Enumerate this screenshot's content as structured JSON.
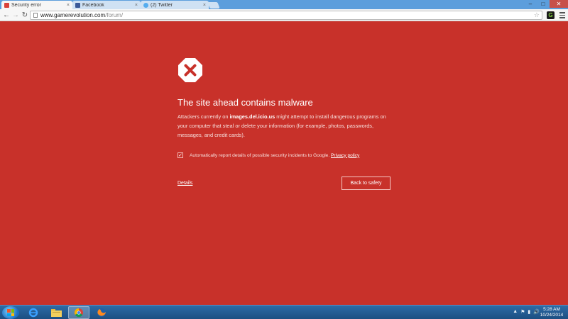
{
  "browser": {
    "tabs": [
      {
        "label": "Security error",
        "active": true,
        "icon": "error-tab-icon"
      },
      {
        "label": "Facebook",
        "active": false,
        "icon": "facebook-icon"
      },
      {
        "label": "(2) Twitter",
        "active": false,
        "icon": "twitter-icon"
      }
    ],
    "close_glyph": "×",
    "window_controls": {
      "minimize": "–",
      "maximize": "□",
      "close": "✕"
    },
    "nav": {
      "back": "←",
      "forward": "→",
      "reload": "↻"
    },
    "address": {
      "host": "www.gamerevolution.com",
      "path": "/forum/"
    },
    "star": "☆",
    "extension_label": "G",
    "colors": {
      "tabstrip": "#5c9edc",
      "page_bg": "#c8312a"
    }
  },
  "warning": {
    "title": "The site ahead contains malware",
    "body_prefix": "Attackers currently on ",
    "body_domain": "images.del.icio.us",
    "body_suffix": " might attempt to install dangerous programs on your computer that steal or delete your information (for example, photos, passwords, messages, and credit cards).",
    "report_label": "Automatically report details of possible security incidents to Google.",
    "report_checked": true,
    "check_glyph": "✓",
    "privacy_link": "Privacy policy",
    "details_link": "Details",
    "back_button": "Back to safety"
  },
  "taskbar": {
    "icons": [
      "start-button",
      "internet-explorer-icon",
      "file-explorer-icon",
      "chrome-icon",
      "firefox-icon"
    ],
    "tray_icons": [
      "▲",
      "⚑",
      "▮",
      "🔊"
    ],
    "clock_time": "5:28 AM",
    "clock_date": "10/24/2014"
  }
}
